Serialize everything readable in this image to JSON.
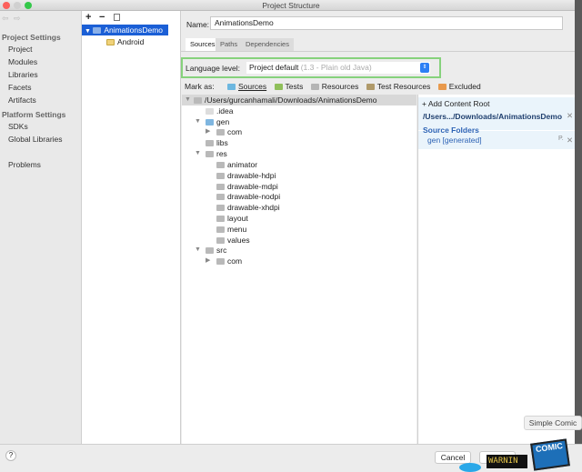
{
  "window": {
    "title": "Project Structure"
  },
  "sidebar": {
    "sections": [
      {
        "title": "Project Settings",
        "items": [
          "Project",
          "Modules",
          "Libraries",
          "Facets",
          "Artifacts"
        ]
      },
      {
        "title": "Platform Settings",
        "items": [
          "SDKs",
          "Global Libraries"
        ]
      }
    ],
    "extra": "Problems"
  },
  "modules": {
    "root": "AnimationsDemo",
    "child": "Android"
  },
  "main": {
    "name_label": "Name:",
    "name_value": "AnimationsDemo",
    "tabs": [
      "Sources",
      "Paths",
      "Dependencies"
    ],
    "language_label": "Language level:",
    "language_value": "Project default",
    "language_hint": "(1.3 - Plain old Java)",
    "mark_as_label": "Mark as:",
    "mark_as": [
      {
        "label": "Sources",
        "color": "#6cb7e0"
      },
      {
        "label": "Tests",
        "color": "#8fbf5a"
      },
      {
        "label": "Resources",
        "color": "#b5b5b5"
      },
      {
        "label": "Test Resources",
        "color": "#b09a6a"
      },
      {
        "label": "Excluded",
        "color": "#e8994c"
      }
    ],
    "tree": [
      {
        "label": "/Users/gurcanhamali/Downloads/AnimationsDemo",
        "level": 0,
        "expanded": true
      },
      {
        "label": ".idea",
        "level": 1
      },
      {
        "label": "gen",
        "level": 1,
        "expanded": true,
        "source": true
      },
      {
        "label": "com",
        "level": 2,
        "collapsed": true
      },
      {
        "label": "libs",
        "level": 1
      },
      {
        "label": "res",
        "level": 1,
        "expanded": true
      },
      {
        "label": "animator",
        "level": 2
      },
      {
        "label": "drawable-hdpi",
        "level": 2
      },
      {
        "label": "drawable-mdpi",
        "level": 2
      },
      {
        "label": "drawable-nodpi",
        "level": 2
      },
      {
        "label": "drawable-xhdpi",
        "level": 2
      },
      {
        "label": "layout",
        "level": 2
      },
      {
        "label": "menu",
        "level": 2
      },
      {
        "label": "values",
        "level": 2
      },
      {
        "label": "src",
        "level": 1,
        "expanded": true
      },
      {
        "label": "com",
        "level": 2,
        "collapsed": true
      }
    ],
    "content_root": {
      "add_label": "+ Add Content Root",
      "path": "/Users.../Downloads/AnimationsDemo",
      "source_folders_title": "Source Folders",
      "source_folder": "gen [generated]"
    }
  },
  "bottom": {
    "help": "?",
    "cancel": "Cancel"
  },
  "dock": {
    "tooltip": "Simple Comic",
    "comic_label": "COMIC",
    "warning_label": "WARNIN"
  }
}
